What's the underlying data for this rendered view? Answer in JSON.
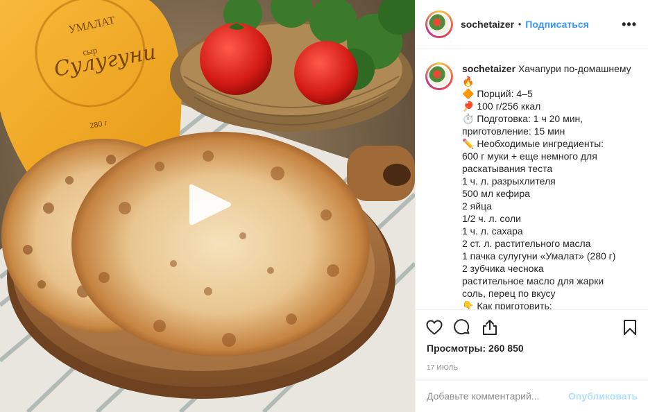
{
  "post": {
    "username": "sochetaizer",
    "separator": "•",
    "follow_label": "Подписаться",
    "more_label": "•••",
    "caption_user": "sochetaizer",
    "caption_lines": [
      "Хачапури по-домашнему",
      "🔥",
      "🔶 Порций: 4–5",
      "🏓 100 г/256 ккал",
      "⏱️ Подготовка: 1 ч 20 мин,",
      "приготовление: 15 мин",
      "✏️ Необходимые ингредиенты:",
      "600 г муки + еще немного для",
      "раскатывания теста",
      "1 ч. л. разрыхлителя",
      "500 мл кефира",
      "2 яйца",
      "1/2 ч. л. соли",
      "1 ч. л. сахара",
      "2 ст. л. растительного масла",
      "1 пачка сулугуни «Умалат» (280 г)",
      "2 зубчика чеснока",
      "растительное масло для жарки",
      "соль, перец по вкусу",
      "👇 Как приготовить:"
    ],
    "views_label": "Просмотры: 260 850",
    "date": "17 июль",
    "comment_placeholder": "Добавьте комментарий...",
    "publish_label": "Опубликовать"
  },
  "package": {
    "brand": "УМАЛАТ",
    "type": "сыр",
    "name": "Сулугуни",
    "weight": "280 г"
  },
  "icons": [
    "like-icon",
    "comment-icon",
    "share-icon",
    "save-icon",
    "play-icon"
  ],
  "colors": {
    "link": "#3897f0",
    "publish_disabled": "#b2dffc",
    "muted": "#8e8e8e",
    "text": "#262626"
  }
}
